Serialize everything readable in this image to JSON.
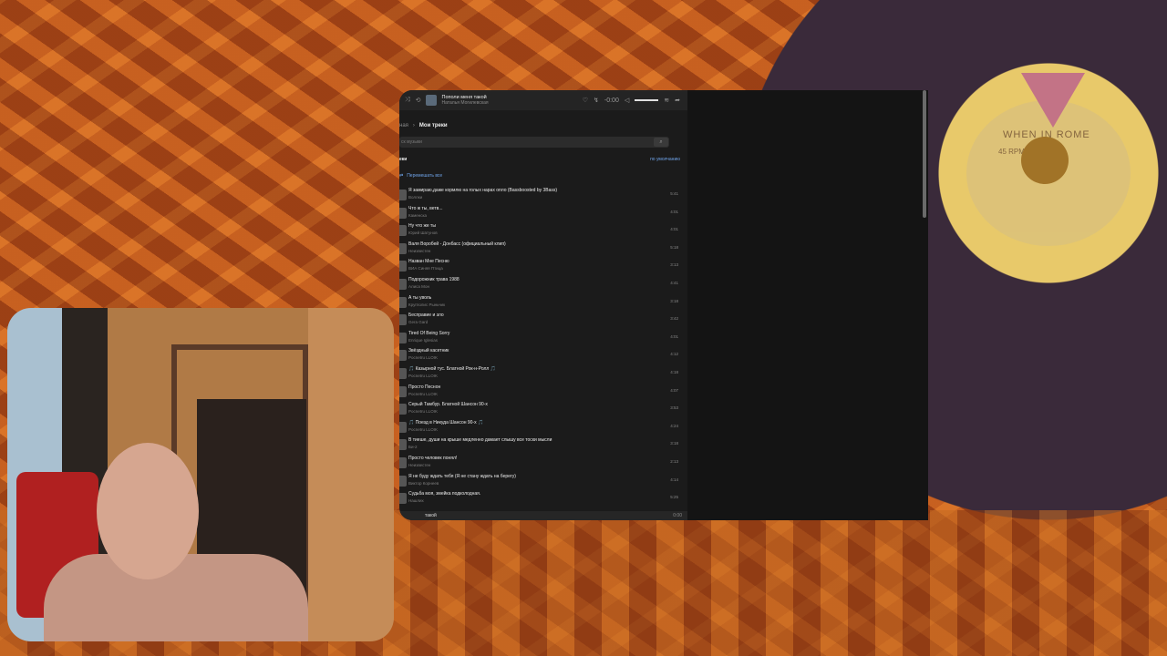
{
  "player": {
    "title": "Пополи меня такой",
    "artist": "Наталья Могилевская",
    "time": "-0:00"
  },
  "breadcrumb": {
    "parent": "ная",
    "current": "Мои треки"
  },
  "search": {
    "placeholder": "ск музыки",
    "button_icon": "search-icon"
  },
  "list": {
    "heading": "еки",
    "sort": "по умолчанию",
    "shuffle": "Перемешать все"
  },
  "tracks": [
    {
      "title": "Я замираю,даже кормлю на голых нарах опло (Bassboosted by 3Bass)",
      "artist": "Воллки",
      "duration": "5:41"
    },
    {
      "title": "Что ж ты, ветв...",
      "artist": "Каменска",
      "duration": "4:01"
    },
    {
      "title": "Ну что же ты",
      "artist": "Юрий Шатунов",
      "duration": "4:01"
    },
    {
      "title": "Валя Воробей - Донбасс (официальный клип)",
      "artist": "Неизвестен",
      "duration": "5:18"
    },
    {
      "title": "Назван Мне Песню",
      "artist": "ВИА Синяя Птица",
      "duration": "3:13"
    },
    {
      "title": "Подорожник трава 1988",
      "artist": "Алиса Мон",
      "duration": "4:41"
    },
    {
      "title": "А ты уволь",
      "artist": "Кругполис Рыньчик",
      "duration": "3:18"
    },
    {
      "title": "Бесправие и зло",
      "artist": "Gera Gard",
      "duration": "3:42"
    },
    {
      "title": "Tired Of Being Sorry",
      "artist": "Enrique Iglesias",
      "duration": "4:01"
    },
    {
      "title": "Звёздный касетник",
      "artist": "Pocnetru LLOIK",
      "duration": "4:12"
    },
    {
      "title": "🎵 Казырной тус. Блатной Рок-н-Ролл 🎵",
      "artist": "Pocnetru LLOIK",
      "duration": "4:18"
    },
    {
      "title": "Просто Песнон",
      "artist": "Pocnetru LLOIK",
      "duration": "4:07"
    },
    {
      "title": "Серый Тамбур. Блатной Шансон 90-х",
      "artist": "Pocnetru LLOIK",
      "duration": "3:53"
    },
    {
      "title": "🎵 Поезд в Никуда Шансон 90-х 🎵",
      "artist": "Pocnetru LLOIK",
      "duration": "4:24"
    },
    {
      "title": "В тиеше, души на крыше медленно дамает слышу все тоски мысли",
      "artist": "Би-2",
      "duration": "3:18"
    },
    {
      "title": "Просто человек понял!",
      "artist": "Неизвестен",
      "duration": "2:13"
    },
    {
      "title": "Я не буду ждать тебя (Я не стану ждать на берегу)",
      "artist": "Виктор Корнеев",
      "duration": "4:14"
    },
    {
      "title": "Судьба моя, змейка подколодная.",
      "artist": "Нашлих",
      "duration": "5:25"
    }
  ],
  "bottom": {
    "title": "такой",
    "duration": "0:00"
  },
  "record": {
    "label": "WHEN IN ROME",
    "rpm": "45 RPM"
  }
}
